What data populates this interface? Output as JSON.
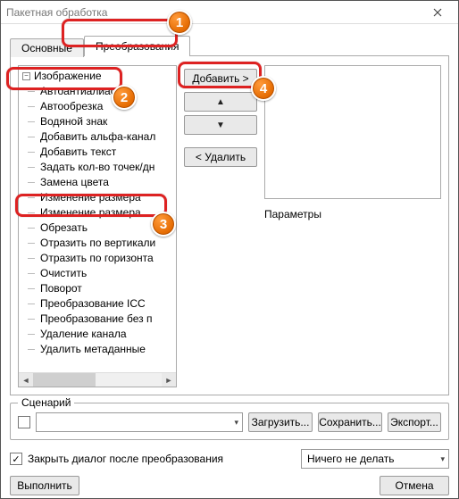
{
  "window": {
    "title": "Пакетная обработка"
  },
  "tabs": {
    "main": "Основные",
    "transform": "Преобразования"
  },
  "tree": {
    "root": "Изображение",
    "items": [
      "Автоантиалиас",
      "Автообрезка",
      "Водяной знак",
      "Добавить альфа-канал",
      "Добавить текст",
      "Задать кол-во точек/дн",
      "Замена цвета",
      "Изменение размера",
      "Изменение размера",
      "Обрезать",
      "Отразить по вертикали",
      "Отразить по горизонта",
      "Очистить",
      "Поворот",
      "Преобразование ICC",
      "Преобразование без п",
      "Удаление канала",
      "Удалить метаданные"
    ]
  },
  "buttons": {
    "add": "Добавить >",
    "up": "▲",
    "down": "▼",
    "delete": "< Удалить",
    "load": "Загрузить...",
    "save": "Сохранить...",
    "export": "Экспорт...",
    "run": "Выполнить",
    "cancel": "Отмена"
  },
  "labels": {
    "parameters": "Параметры",
    "scenario": "Сценарий",
    "close_after": "Закрыть диалог после преобразования",
    "after_action": "Ничего не делать"
  },
  "badges": {
    "b1": "1",
    "b2": "2",
    "b3": "3",
    "b4": "4"
  }
}
